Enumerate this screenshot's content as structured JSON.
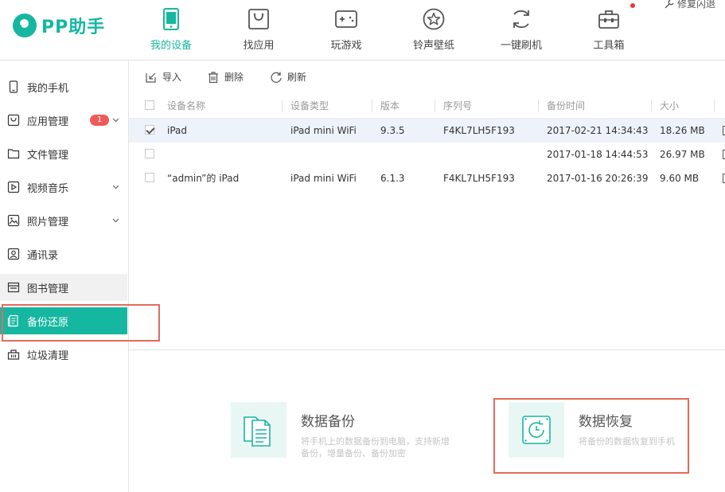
{
  "app": {
    "name": "PP助手"
  },
  "nav": {
    "items": [
      {
        "label": "我的设备",
        "icon": "device-icon",
        "active": true
      },
      {
        "label": "找应用",
        "icon": "bag-icon",
        "active": false
      },
      {
        "label": "玩游戏",
        "icon": "gamepad-icon",
        "active": false
      },
      {
        "label": "铃声壁纸",
        "icon": "star-icon",
        "active": false
      },
      {
        "label": "一键刷机",
        "icon": "refresh-cycle-icon",
        "active": false
      },
      {
        "label": "工具箱",
        "icon": "toolbox-icon",
        "active": false
      }
    ],
    "repair_label": "修复闪退"
  },
  "sidebar": {
    "items": [
      {
        "label": "我的手机",
        "icon": "phone-icon"
      },
      {
        "label": "应用管理",
        "icon": "app-bag-icon",
        "badge": "1",
        "expandable": true
      },
      {
        "label": "文件管理",
        "icon": "folder-icon"
      },
      {
        "label": "视频音乐",
        "icon": "play-icon",
        "expandable": true
      },
      {
        "label": "照片管理",
        "icon": "photo-icon",
        "expandable": true
      },
      {
        "label": "通讯录",
        "icon": "contacts-icon"
      },
      {
        "label": "图书管理",
        "icon": "book-icon"
      },
      {
        "label": "备份还原",
        "icon": "backup-icon",
        "active": true
      },
      {
        "label": "垃圾清理",
        "icon": "trash-bin-icon"
      }
    ]
  },
  "toolbar": {
    "import_label": "导入",
    "delete_label": "删除",
    "refresh_label": "刷新"
  },
  "table": {
    "columns": [
      "设备名称",
      "设备类型",
      "版本",
      "序列号",
      "备份时间",
      "大小"
    ],
    "rows": [
      {
        "checked": true,
        "name": "iPad",
        "type": "iPad mini WiFi",
        "version": "9.3.5",
        "serial": "F4KL7LH5F193",
        "time": "2017-02-21 14:34:43",
        "size": "18.26 MB"
      },
      {
        "checked": false,
        "name": "",
        "type": "",
        "version": "",
        "serial": "",
        "time": "2017-01-18 14:44:53",
        "size": "26.97 MB"
      },
      {
        "checked": false,
        "name": "“admin”的 iPad",
        "type": "iPad mini WiFi",
        "version": "6.1.3",
        "serial": "F4KL7LH5F193",
        "time": "2017-01-16 20:26:39",
        "size": "9.60 MB"
      }
    ]
  },
  "cards": {
    "backup": {
      "title": "数据备份",
      "desc_line1": "将手机上的数据备份到电脑，支持新增",
      "desc_line2": "备份，增量备份、备份加密"
    },
    "restore": {
      "title": "数据恢复",
      "desc": "将备份的数据恢复到手机"
    }
  },
  "colors": {
    "accent": "#15b7a1",
    "highlight": "#e46a5c",
    "badge": "#f05a5a"
  }
}
